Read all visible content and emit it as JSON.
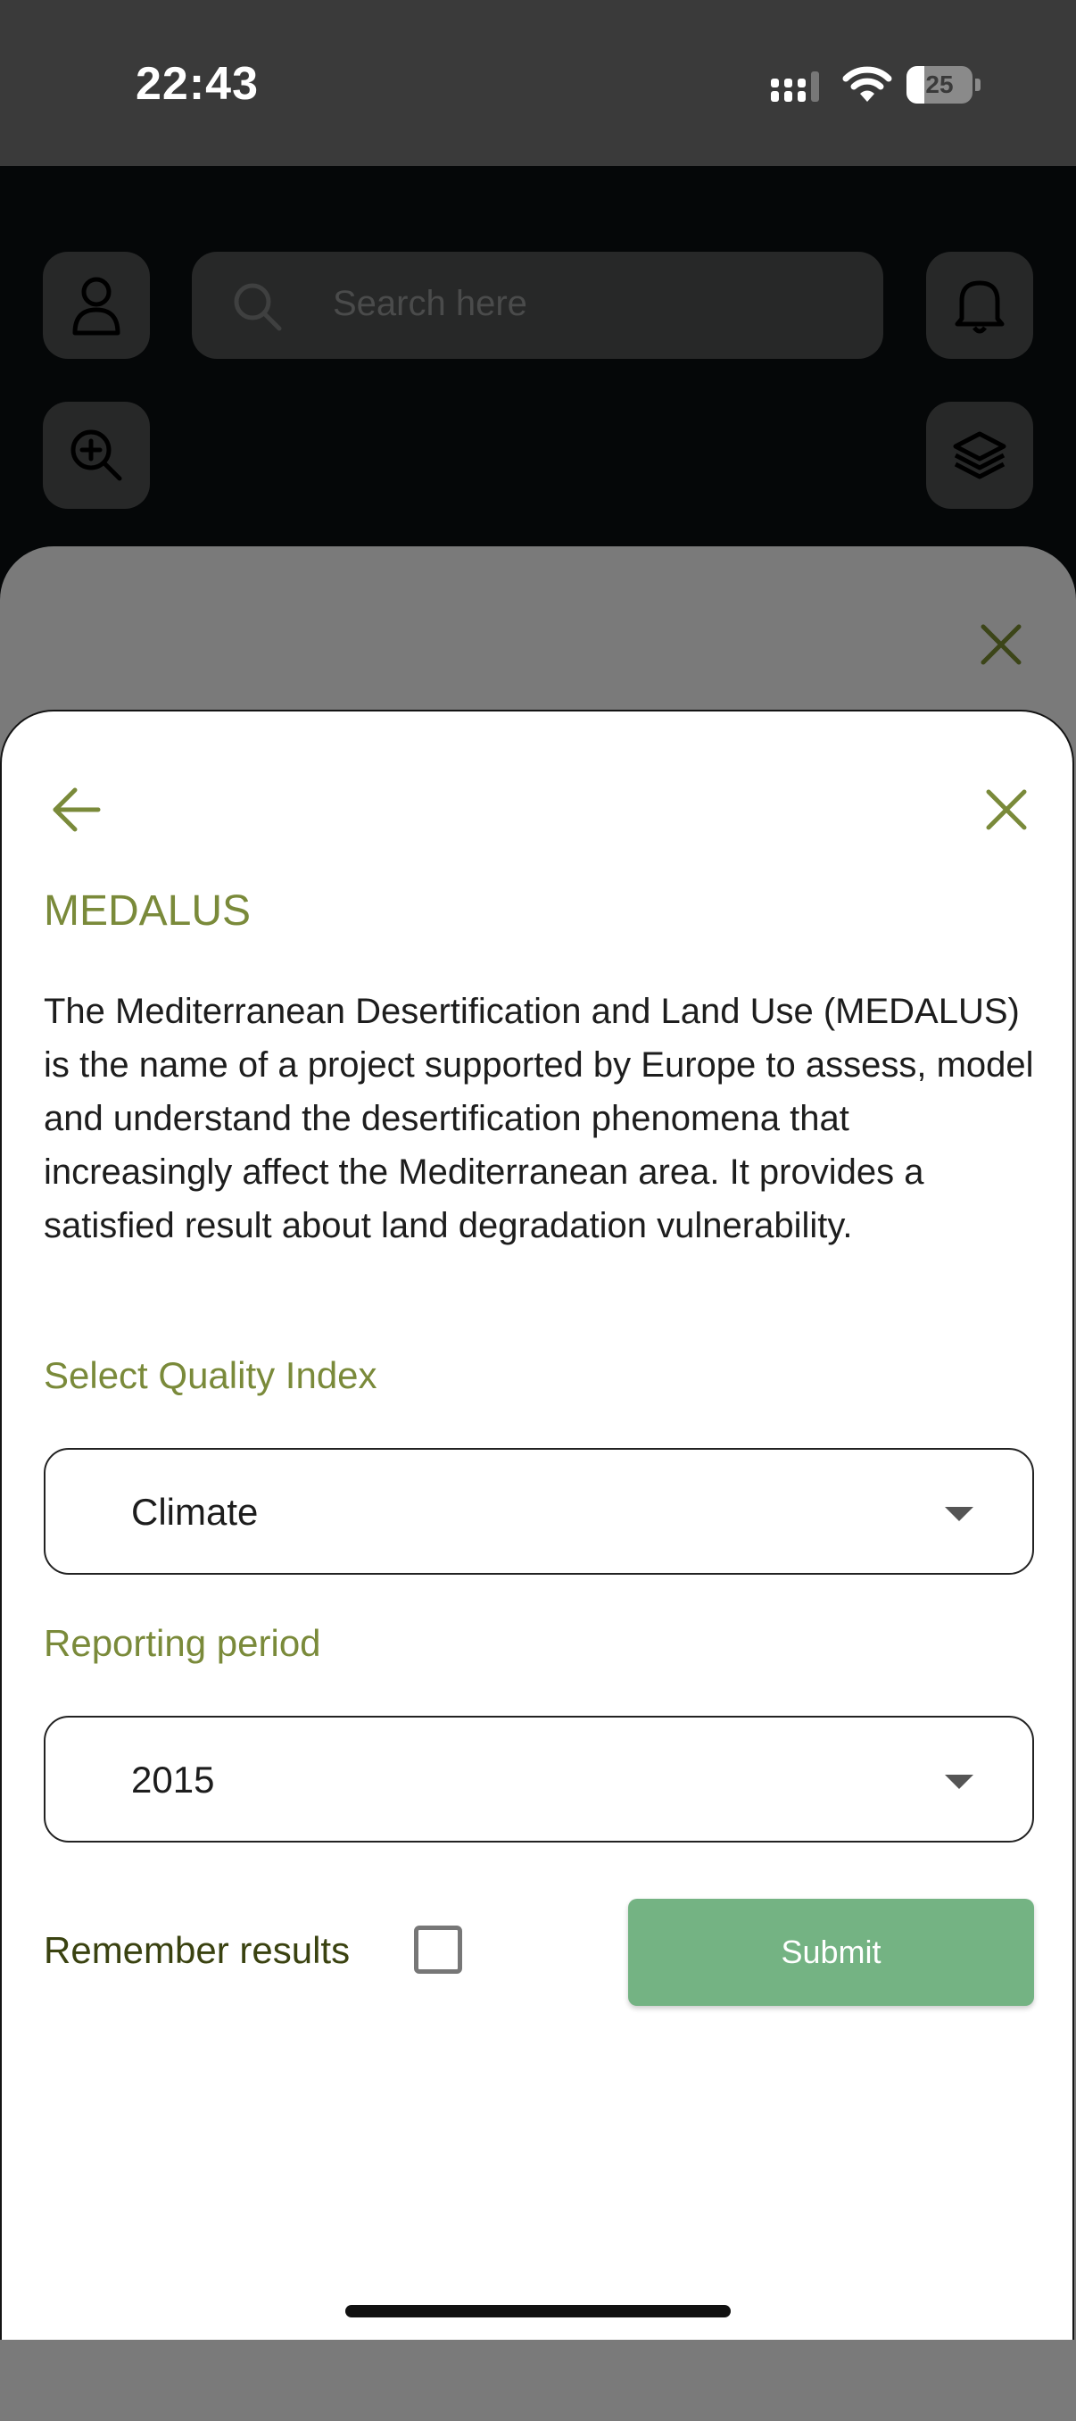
{
  "status_bar": {
    "time": "22:43",
    "battery": "25"
  },
  "search": {
    "placeholder": "Search here"
  },
  "icons": {
    "profile": "person-icon",
    "search": "search-icon",
    "notifications": "bell-icon",
    "zoom": "zoom-in-icon",
    "layers": "layers-icon",
    "back": "arrow-left-icon",
    "close": "close-icon"
  },
  "colors": {
    "accent": "#7a8a3a",
    "submit": "#74b383"
  },
  "panel": {
    "title": "MEDALUS",
    "description": "The Mediterranean Desertification and Land Use (MEDALUS) is the name of a project supported by Europe to assess, model and understand the desertification phenomena that increasingly affect the Mediterranean area. It provides a satisfied result about land degradation vulnerability.",
    "quality_label": "Select Quality Index",
    "quality_value": "Climate",
    "period_label": "Reporting period",
    "period_value": "2015",
    "remember_label": "Remember results",
    "remember_checked": false,
    "submit_label": "Submit"
  }
}
